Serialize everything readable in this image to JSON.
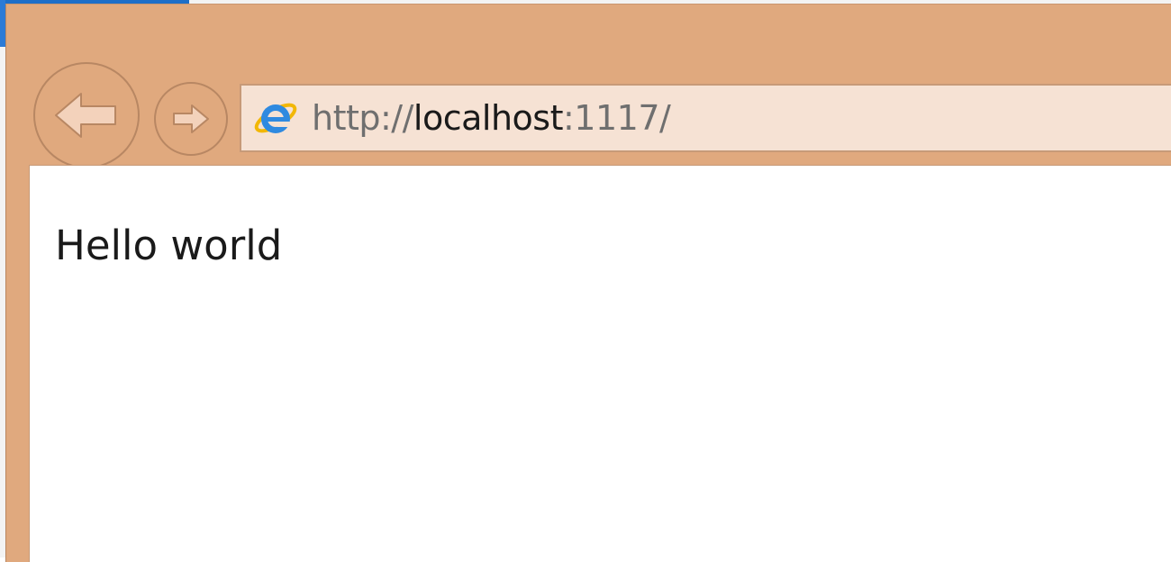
{
  "browser": {
    "address": {
      "scheme": "http://",
      "host": "localhost",
      "rest": ":1117/"
    },
    "nav": {
      "back_icon": "arrow-left-icon",
      "forward_icon": "arrow-right-icon",
      "site_icon": "internet-explorer-icon"
    },
    "colors": {
      "frame": "#e0a97e",
      "address_bg": "#f6e2d4",
      "nav_stroke": "#b88763",
      "desktop_accent": "#1e6fc8"
    }
  },
  "page": {
    "text": "Hello world"
  }
}
